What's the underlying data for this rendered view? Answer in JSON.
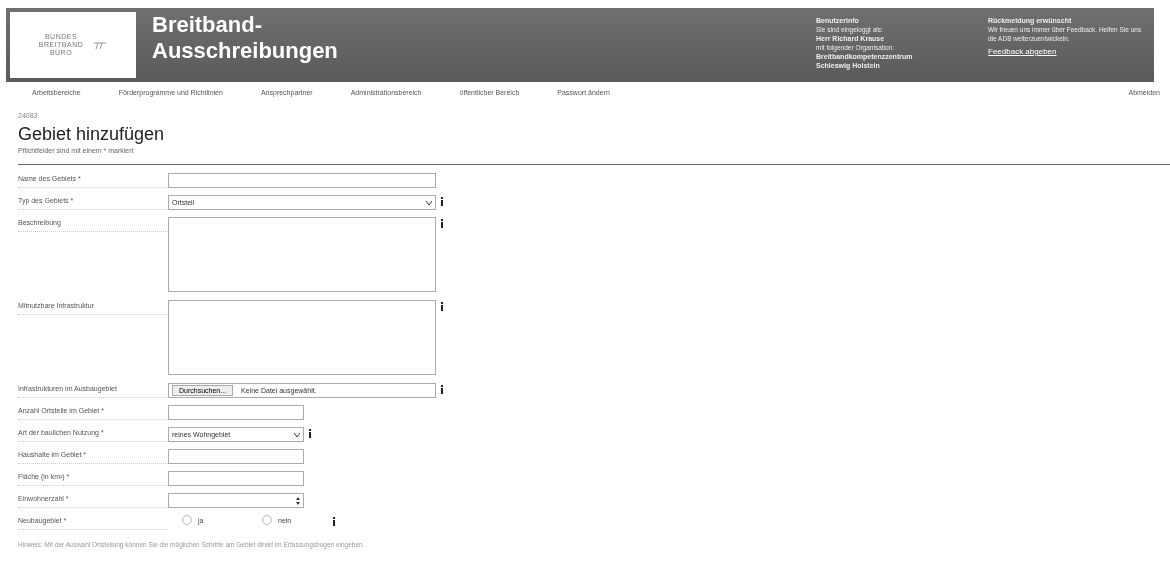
{
  "header": {
    "logo": [
      "BUNDES",
      "BREITBAND",
      "BÜRO"
    ],
    "title": [
      "Breitband-",
      "Ausschreibungen"
    ],
    "user_info": {
      "heading": "Benutzerinfo",
      "logged_in_as": "Sie sind eingeloggt als:",
      "name": "Herr Richard Krause",
      "org_intro": "mit folgender Organisation:",
      "org": [
        "Breitbandkompetenzzentrum",
        "Schleswig Holstein"
      ]
    },
    "feedback": {
      "heading": "Rückmeldung erwünscht",
      "text": "Wir freuen uns immer über Feedback. Helfen Sie uns die ADB weiterzuentwickeln.",
      "link": "Feedback abgeben"
    }
  },
  "nav": {
    "items": [
      "Arbeitsbereiche",
      "Förderprogramme und Richtlinien",
      "Ansprechpartner",
      "Administrationsbereich",
      "öffentlicher Bereich",
      "Passwort ändern"
    ],
    "logout": "Abmelden"
  },
  "breadcrumb": "24083",
  "page_title": "Gebiet hinzufügen",
  "required_note": "Pflichtfelder sind mit einem * markiert",
  "fields": [
    {
      "kind": "text",
      "label": "Name des Gebiets *",
      "wide": true,
      "info": false
    },
    {
      "kind": "select",
      "label": "Typ des Gebiets *",
      "value": "Ortsteil",
      "wide": true,
      "info": true
    },
    {
      "kind": "textarea",
      "label": "Beschreibung",
      "wide": true,
      "info": true
    },
    {
      "kind": "textarea",
      "label": "Mitnutzbare Infrastruktur",
      "wide": true,
      "info": true
    },
    {
      "kind": "file",
      "label": "Infrastrukturen im Ausbaugebiet",
      "button": "Durchsuchen...",
      "value": "Keine Datei ausgewählt.",
      "wide": true,
      "info": true
    },
    {
      "kind": "text",
      "label": "Anzahl Ortsteile im Gebiet *",
      "wide": false,
      "info": false
    },
    {
      "kind": "select",
      "label": "Art der baulichen Nutzung *",
      "value": "reines Wohngebiet",
      "wide": false,
      "info": true
    },
    {
      "kind": "text",
      "label": "Haushalte im Gebiet *",
      "wide": false,
      "info": false
    },
    {
      "kind": "text",
      "label": "Fläche (in km²) *",
      "wide": false,
      "info": false
    },
    {
      "kind": "number",
      "label": "Einwohnerzahl *",
      "wide": false,
      "info": false
    },
    {
      "kind": "radio",
      "label": "Neubaugebiet *",
      "options": [
        {
          "label": "ja",
          "selected": false
        },
        {
          "label": "nein",
          "selected": false
        }
      ],
      "info": true
    }
  ],
  "hint": "Hinweis: Mit der Auswahl Ortsteilung können Sie die möglichen Schritte am Gebiet direkt im Erfassungsbogen eingeben."
}
